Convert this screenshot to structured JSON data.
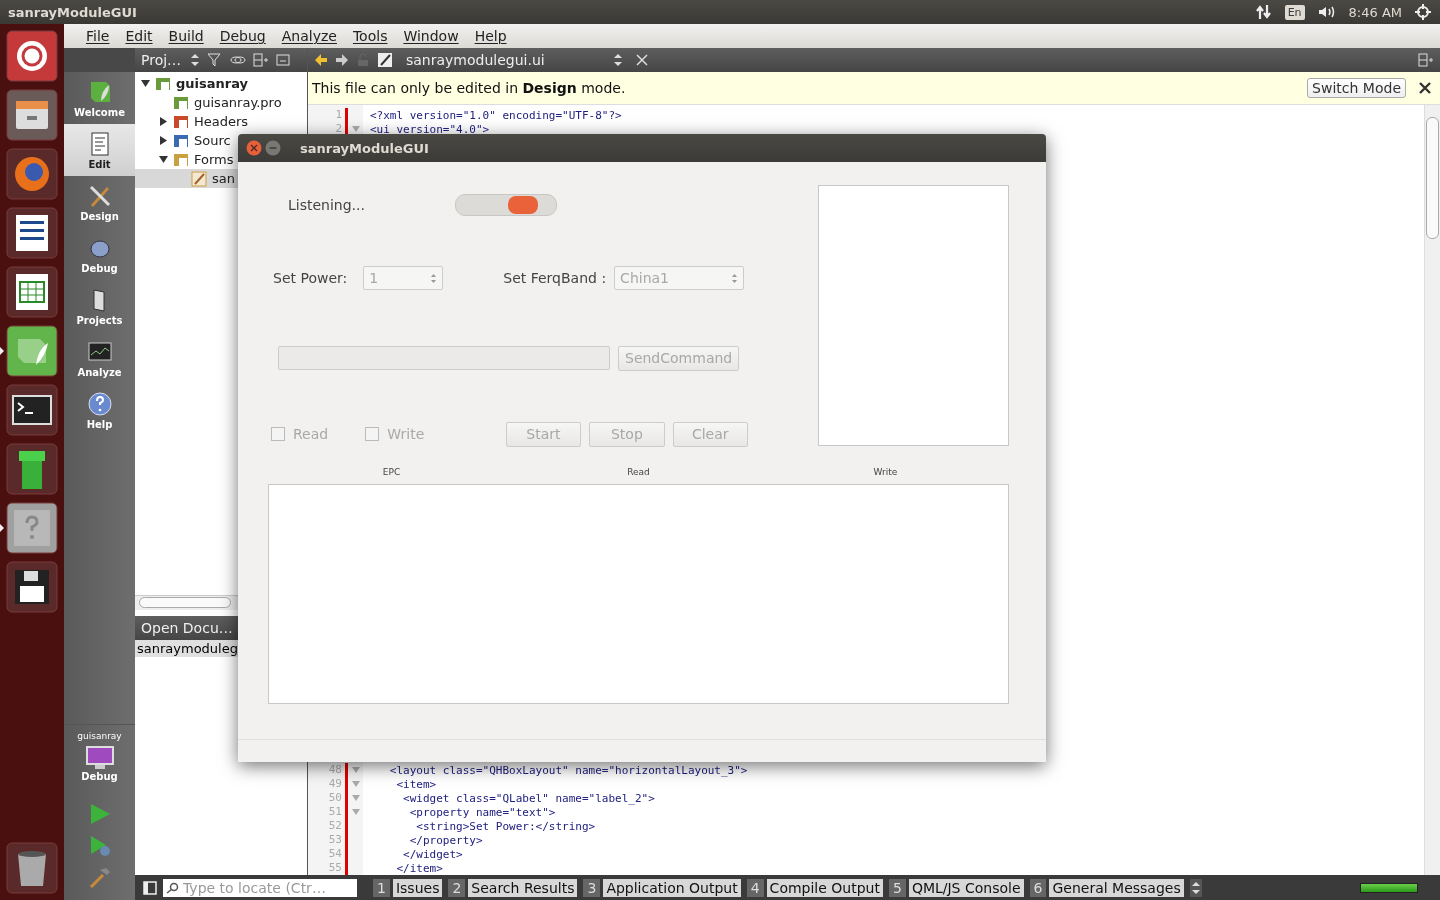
{
  "top_panel": {
    "title": "sanrayModuleGUI",
    "keyboard": "En",
    "time": "8:46 AM"
  },
  "launcher": [
    {
      "kind": "dash",
      "running": false
    },
    {
      "kind": "files",
      "running": false
    },
    {
      "kind": "firefox",
      "running": false
    },
    {
      "kind": "writer",
      "running": false
    },
    {
      "kind": "calc",
      "running": false
    },
    {
      "kind": "qt",
      "running": true
    },
    {
      "kind": "terminal",
      "running": false
    },
    {
      "kind": "pipe",
      "running": false
    },
    {
      "kind": "unknown",
      "running": true
    },
    {
      "kind": "floppy",
      "running": false
    },
    {
      "kind": "trash",
      "running": false
    }
  ],
  "menu": [
    "File",
    "Edit",
    "Build",
    "Debug",
    "Analyze",
    "Tools",
    "Window",
    "Help"
  ],
  "modes": [
    {
      "label": "Welcome",
      "kind": "welcome",
      "selected": false
    },
    {
      "label": "Edit",
      "kind": "edit",
      "selected": true
    },
    {
      "label": "Design",
      "kind": "design",
      "selected": false
    },
    {
      "label": "Debug",
      "kind": "debug",
      "selected": false
    },
    {
      "label": "Projects",
      "kind": "projects",
      "selected": false
    },
    {
      "label": "Analyze",
      "kind": "analyze",
      "selected": false
    },
    {
      "label": "Help",
      "kind": "help",
      "selected": false
    }
  ],
  "kit": {
    "project": "guisanray",
    "label": "Debug"
  },
  "project_pane": {
    "title": "Proj…",
    "tree": [
      {
        "label": "guisanray",
        "kind": "project",
        "expanded": true,
        "selected": false,
        "children": [
          {
            "label": "guisanray.pro",
            "kind": "pro",
            "selected": false
          },
          {
            "label": "Headers",
            "kind": "headers",
            "expanded": false,
            "selected": false
          },
          {
            "label": "Sourc",
            "kind": "sources",
            "expanded": false,
            "selected": false
          },
          {
            "label": "Forms",
            "kind": "forms",
            "expanded": true,
            "selected": false,
            "children": [
              {
                "label": "san",
                "kind": "ui",
                "selected": true
              }
            ]
          }
        ]
      }
    ]
  },
  "open_documents": {
    "title": "Open Docu…",
    "items": [
      "sanraymoduleg"
    ]
  },
  "editor": {
    "file": "sanraymodulegui.ui",
    "info": "This file can only be edited in **Design** mode.",
    "switch_button": "Switch Mode",
    "top_lines": [
      {
        "number": "1",
        "text": "<?xml version=\"1.0\" encoding=\"UTF-8\"?>",
        "foldable": false
      },
      {
        "number": "2",
        "text": "<ui version=\"4.0\">",
        "foldable": true
      }
    ],
    "bottom_lines": [
      {
        "number": "48",
        "text": "   <layout class=\"QHBoxLayout\" name=\"horizontalLayout_3\">",
        "foldable": true
      },
      {
        "number": "49",
        "text": "    <item>",
        "foldable": true
      },
      {
        "number": "50",
        "text": "     <widget class=\"QLabel\" name=\"label_2\">",
        "foldable": true
      },
      {
        "number": "51",
        "text": "      <property name=\"text\">",
        "foldable": true
      },
      {
        "number": "52",
        "text": "       <string>Set Power:</string>",
        "foldable": false
      },
      {
        "number": "53",
        "text": "      </property>",
        "foldable": false
      },
      {
        "number": "54",
        "text": "     </widget>",
        "foldable": false
      },
      {
        "number": "55",
        "text": "    </item>",
        "foldable": false
      }
    ]
  },
  "dialog": {
    "title": "sanrayModuleGUI",
    "listening": {
      "label": "Listening...",
      "on": true
    },
    "power": {
      "label": "Set Power:",
      "value": "1",
      "disabled": true
    },
    "band": {
      "label": "Set FerqBand :",
      "value": "China1",
      "disabled": true
    },
    "command": {
      "disabled": true
    },
    "send_button": {
      "label": "SendCommand",
      "disabled": true
    },
    "checkboxes": [
      {
        "label": "Read",
        "checked": false,
        "disabled": true
      },
      {
        "label": "Write",
        "checked": false,
        "disabled": true
      }
    ],
    "buttons": [
      {
        "label": "Start",
        "disabled": true
      },
      {
        "label": "Stop",
        "disabled": true
      },
      {
        "label": "Clear",
        "disabled": true
      }
    ],
    "columns": [
      "EPC",
      "Read",
      "Write"
    ]
  },
  "status_bar": {
    "placeholder": "Type to locate (Ctr…",
    "panes": [
      {
        "number": "1",
        "label": "Issues"
      },
      {
        "number": "2",
        "label": "Search Results"
      },
      {
        "number": "3",
        "label": "Application Output"
      },
      {
        "number": "4",
        "label": "Compile Output"
      },
      {
        "number": "5",
        "label": "QML/JS Console"
      },
      {
        "number": "6",
        "label": "General Messages"
      }
    ],
    "progress": {
      "level": 1
    }
  }
}
